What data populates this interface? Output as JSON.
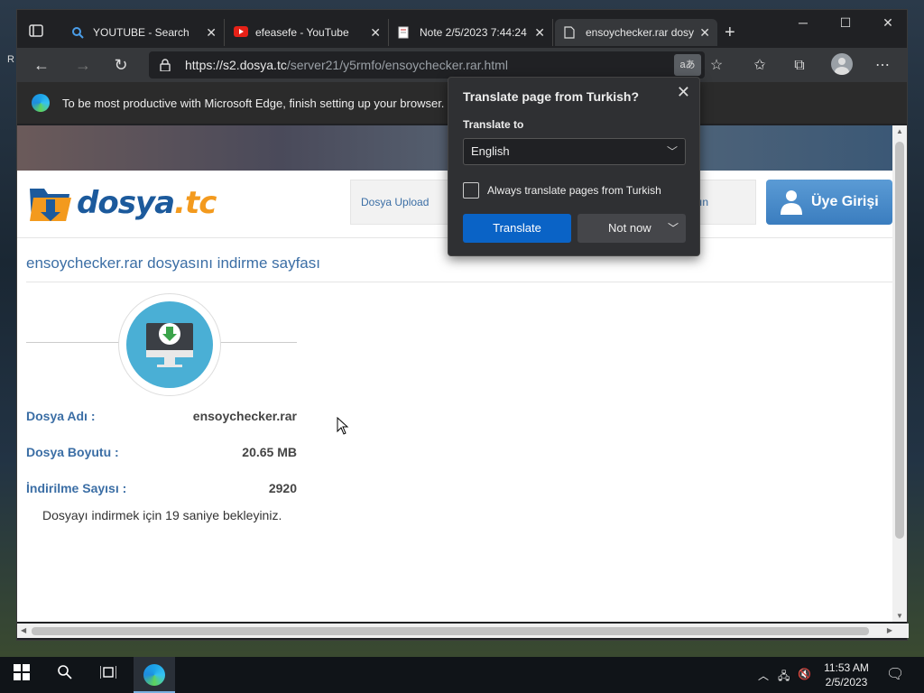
{
  "desktop": {
    "left_text": "R"
  },
  "tabs": [
    {
      "title": "YOUTUBE - Search",
      "icon": "search-icon"
    },
    {
      "title": "efeasefe - YouTube",
      "icon": "youtube-icon"
    },
    {
      "title": "Note 2/5/2023 7:44:24",
      "icon": "note-icon"
    },
    {
      "title": "ensoychecker.rar dosyası",
      "icon": "page-icon"
    }
  ],
  "toolbar": {
    "url_host": "https://s2.dosya.tc",
    "url_path": "/server21/y5rmfo/ensoychecker.rar.html",
    "translate_icon_text": "aあ"
  },
  "infobar": {
    "text": "To be most productive with Microsoft Edge, finish setting up your browser."
  },
  "site": {
    "logo_main": "dosya",
    "logo_tld": ".tc",
    "nav_upload": "Dosya Upload",
    "nav_partial": "sın",
    "login": "Üye Girişi",
    "page_title": "ensoychecker.rar dosyasını indirme sayfası",
    "file_name_label": "Dosya Adı :",
    "file_name": "ensoychecker.rar",
    "file_size_label": "Dosya Boyutu :",
    "file_size": "20.65 MB",
    "downloads_label": "İndirilme Sayısı :",
    "downloads": "2920",
    "wait_text": "Dosyayı indirmek için 19 saniye bekleyiniz."
  },
  "popup": {
    "title": "Translate page from Turkish?",
    "translate_to_label": "Translate to",
    "language": "English",
    "always_label": "Always translate pages from Turkish",
    "translate_button": "Translate",
    "not_now_button": "Not now"
  },
  "taskbar": {
    "time": "11:53 AM",
    "date": "2/5/2023"
  }
}
